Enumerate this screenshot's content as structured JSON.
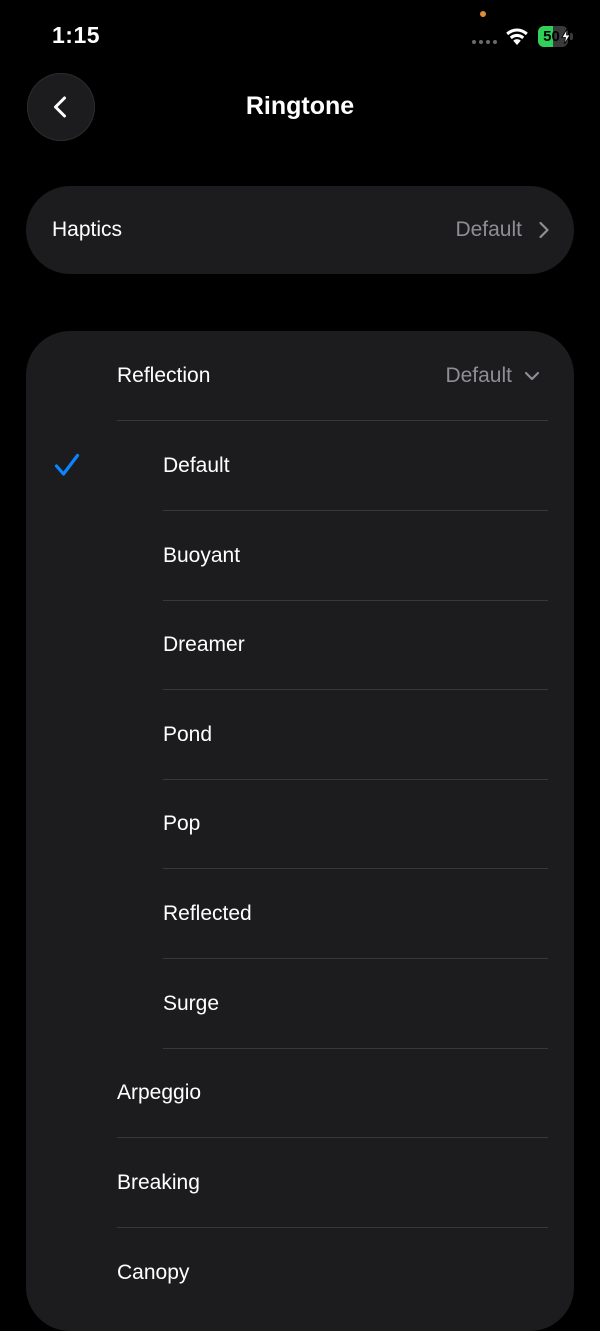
{
  "status_bar": {
    "time": "1:15",
    "battery_percent": "50"
  },
  "header": {
    "title": "Ringtone",
    "back_icon": "chevron-left-icon"
  },
  "haptics": {
    "label": "Haptics",
    "value": "Default"
  },
  "ringtones": {
    "group": {
      "label": "Reflection",
      "value": "Default",
      "options": [
        {
          "label": "Default",
          "selected": true
        },
        {
          "label": "Buoyant",
          "selected": false
        },
        {
          "label": "Dreamer",
          "selected": false
        },
        {
          "label": "Pond",
          "selected": false
        },
        {
          "label": "Pop",
          "selected": false
        },
        {
          "label": "Reflected",
          "selected": false
        },
        {
          "label": "Surge",
          "selected": false
        }
      ]
    },
    "others": [
      {
        "label": "Arpeggio"
      },
      {
        "label": "Breaking"
      },
      {
        "label": "Canopy"
      }
    ]
  },
  "colors": {
    "accent": "#0a84ff",
    "battery": "#30d158",
    "card": "#1c1c1e",
    "secondary_text": "#8e8e93"
  }
}
